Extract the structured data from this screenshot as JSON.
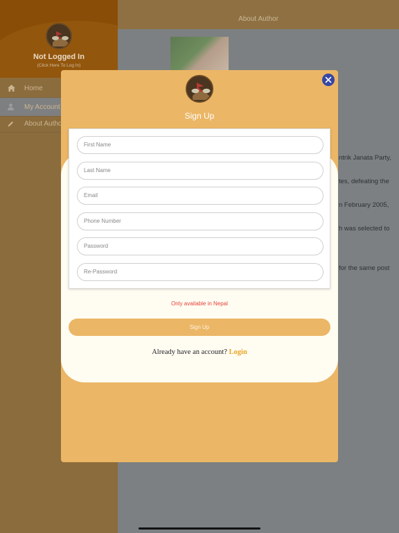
{
  "sidebar": {
    "title": "Not Logged In",
    "subtitle": "(Click Here To Log In)",
    "items": [
      {
        "label": "Home",
        "icon": "home-icon"
      },
      {
        "label": "My Account",
        "icon": "user-icon"
      },
      {
        "label": "About Author",
        "icon": "pencil-icon"
      }
    ]
  },
  "header": {
    "title": "About Author"
  },
  "background_text": {
    "line1": "ntrik Janata Party,",
    "line2": "tes, defeating the",
    "line3": "n February 2005,",
    "line4": "h was selected to",
    "line5": "for the same post"
  },
  "modal": {
    "title": "Sign Up",
    "close_icon": "close-icon",
    "fields": {
      "first_name": "First Name",
      "last_name": "Last Name",
      "email": "Email",
      "phone": "Phone Number",
      "password": "Password",
      "repassword": "Re-Password"
    },
    "note": "Only available in Nepal",
    "signup_label": "Sign Up",
    "login_prompt": "Already have an account?",
    "login_label": "Login"
  },
  "colors": {
    "accent": "#ebb666",
    "close_button": "#3646a4",
    "note": "#e2443a",
    "login_link": "#e8a521"
  }
}
